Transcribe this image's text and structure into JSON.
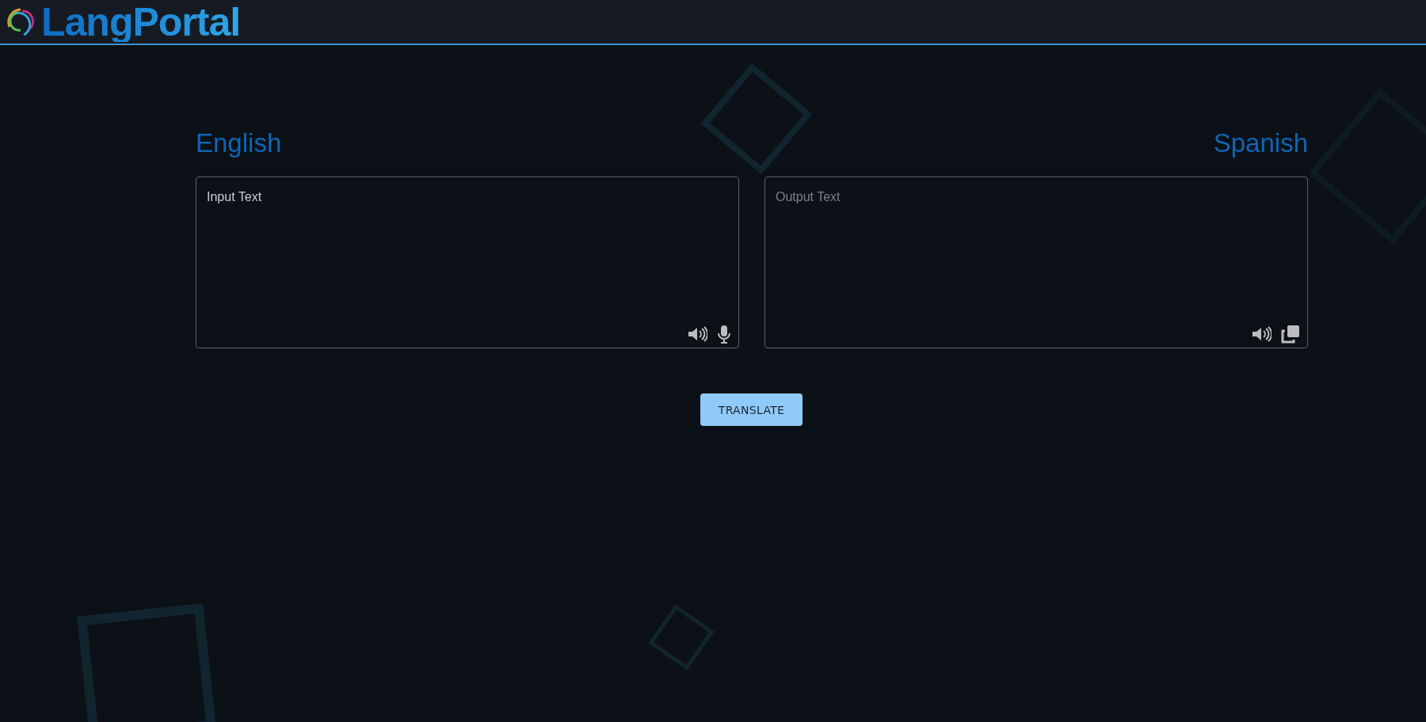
{
  "header": {
    "logo_text": "LangPortal"
  },
  "source": {
    "language": "English",
    "placeholder": "Input Text"
  },
  "target": {
    "language": "Spanish",
    "placeholder": "Output Text"
  },
  "translate_button": {
    "label": "TRANSLATE"
  }
}
